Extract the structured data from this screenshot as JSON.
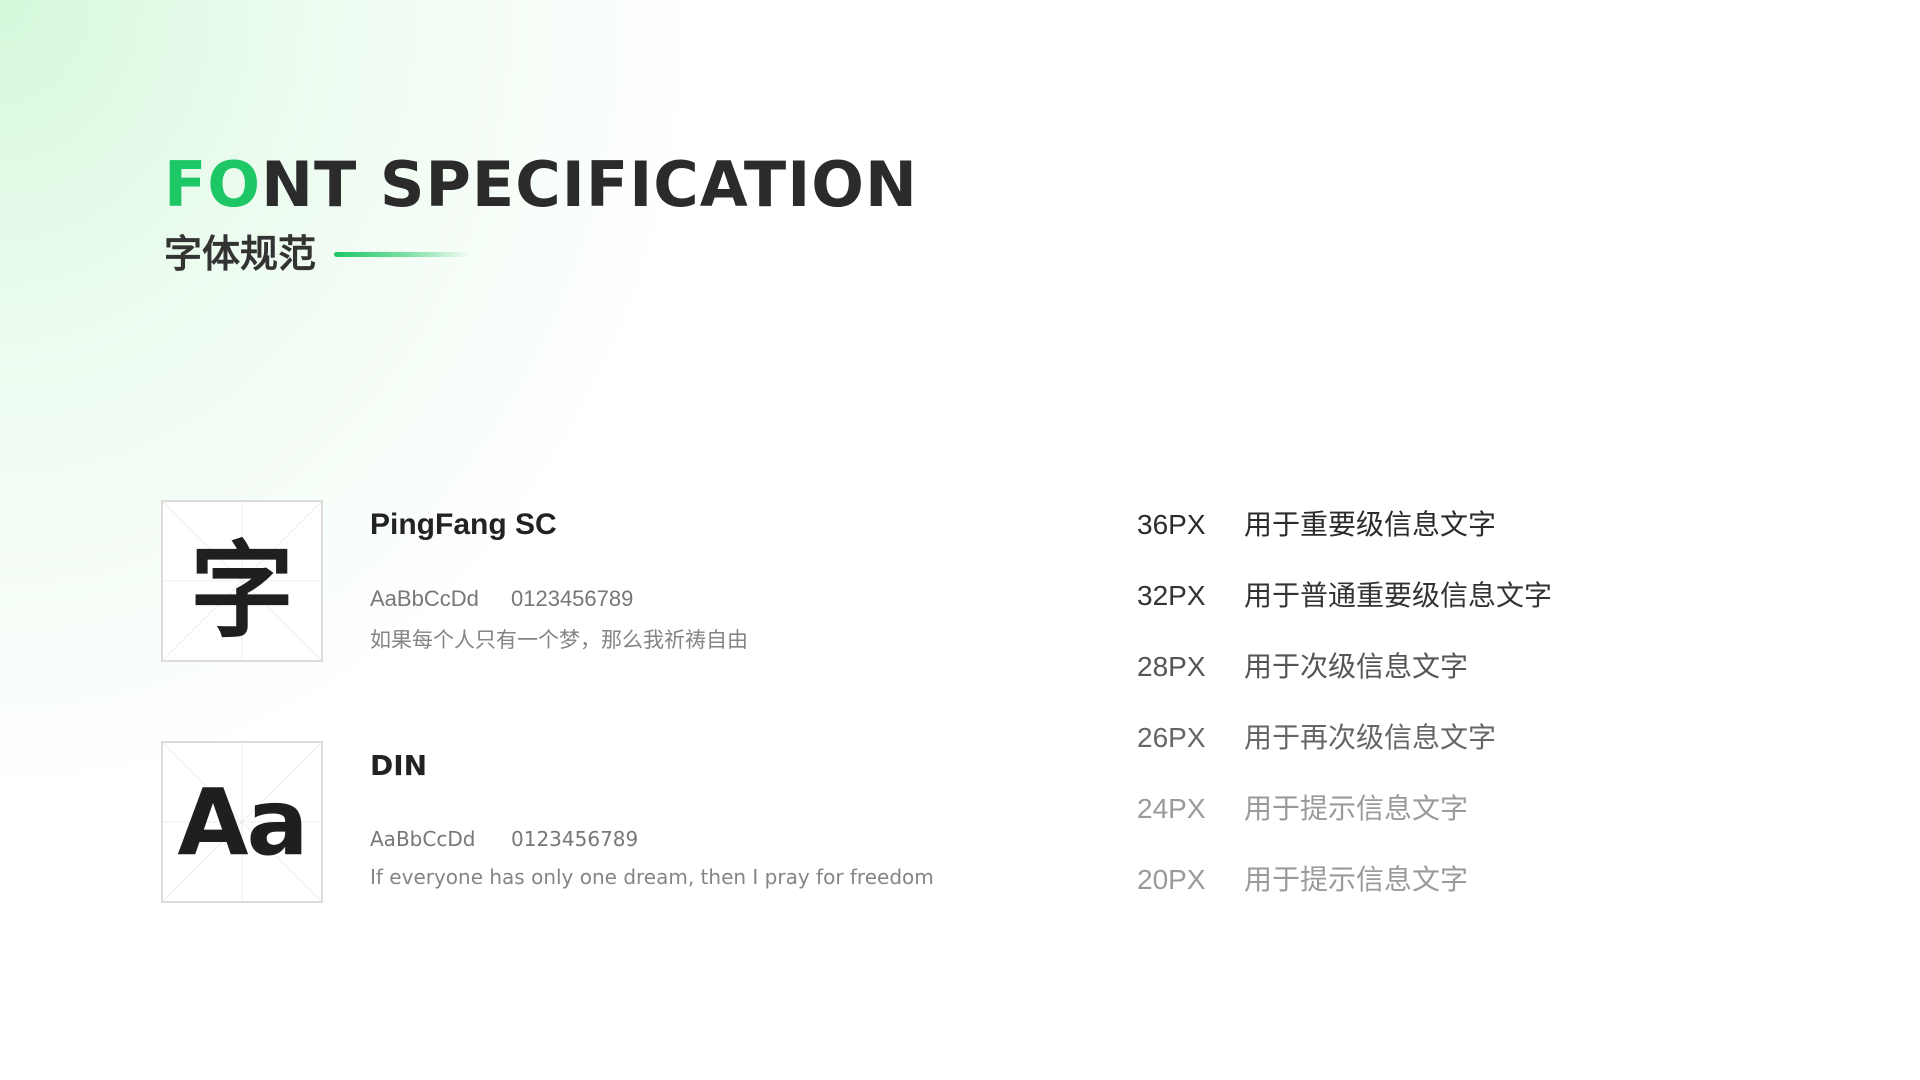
{
  "heading": {
    "title_accent": "FO",
    "title_rest": "NT SPECIFICATION",
    "subtitle": "字体规范"
  },
  "specimens": [
    {
      "glyph": "字",
      "font_name": "PingFang SC",
      "latin_sample": "AaBbCcDd",
      "digits_sample": "0123456789",
      "sentence": "如果每个人只有一个梦，那么我祈祷自由"
    },
    {
      "glyph": "Aa",
      "font_name": "DIN",
      "latin_sample": "AaBbCcDd",
      "digits_sample": "0123456789",
      "sentence": "If everyone has only one dream, then I pray for freedom"
    }
  ],
  "sizes": [
    {
      "size": "36PX",
      "desc": "用于重要级信息文字",
      "color": "#2b2b2b"
    },
    {
      "size": "32PX",
      "desc": "用于普通重要级信息文字",
      "color": "#333333"
    },
    {
      "size": "28PX",
      "desc": "用于次级信息文字",
      "color": "#555555"
    },
    {
      "size": "26PX",
      "desc": "用于再次级信息文字",
      "color": "#666666"
    },
    {
      "size": "24PX",
      "desc": "用于提示信息文字",
      "color": "#9a9a9a"
    },
    {
      "size": "20PX",
      "desc": "用于提示信息文字",
      "color": "#9a9a9a"
    }
  ],
  "colors": {
    "accent": "#1dc765",
    "title": "#2b2b2b"
  }
}
